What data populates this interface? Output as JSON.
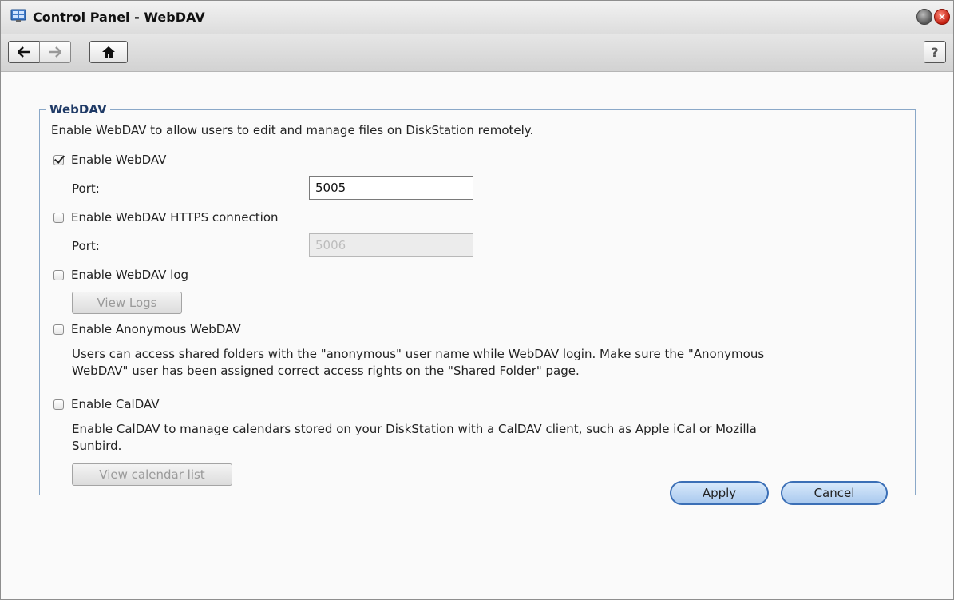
{
  "window": {
    "title": "Control Panel - WebDAV",
    "icon": "control-panel-icon"
  },
  "toolbar": {
    "back_icon": "arrow-left-icon",
    "forward_icon": "arrow-right-icon",
    "home_icon": "home-icon",
    "help_label": "?"
  },
  "webdav": {
    "section_title": "WebDAV",
    "description": "Enable WebDAV to allow users to edit and manage files on DiskStation remotely.",
    "enable_webdav": {
      "label": "Enable WebDAV",
      "checked": true
    },
    "port_label": "Port:",
    "port_value": "5005",
    "enable_https": {
      "label": "Enable WebDAV HTTPS connection",
      "checked": false
    },
    "https_port_label": "Port:",
    "https_port_value": "5006",
    "enable_log": {
      "label": "Enable WebDAV log",
      "checked": false
    },
    "view_logs_label": "View Logs",
    "enable_anonymous": {
      "label": "Enable Anonymous WebDAV",
      "checked": false
    },
    "anonymous_note_line1": "Users can access shared folders with the \"anonymous\" user name while WebDAV login. Make sure the \"Anonymous",
    "anonymous_note_line2": "WebDAV\" user has been assigned correct access rights on the \"Shared Folder\" page.",
    "enable_caldav": {
      "label": "Enable CalDAV",
      "checked": false
    },
    "caldav_note_line1": "Enable CalDAV to manage calendars stored on your DiskStation with a CalDAV client, such as Apple iCal or Mozilla",
    "caldav_note_line2": "Sunbird.",
    "view_calendar_label": "View calendar list"
  },
  "footer": {
    "apply_label": "Apply",
    "cancel_label": "Cancel"
  },
  "colors": {
    "accent": "#3b6fb6",
    "section_border": "#8aa8c8"
  }
}
